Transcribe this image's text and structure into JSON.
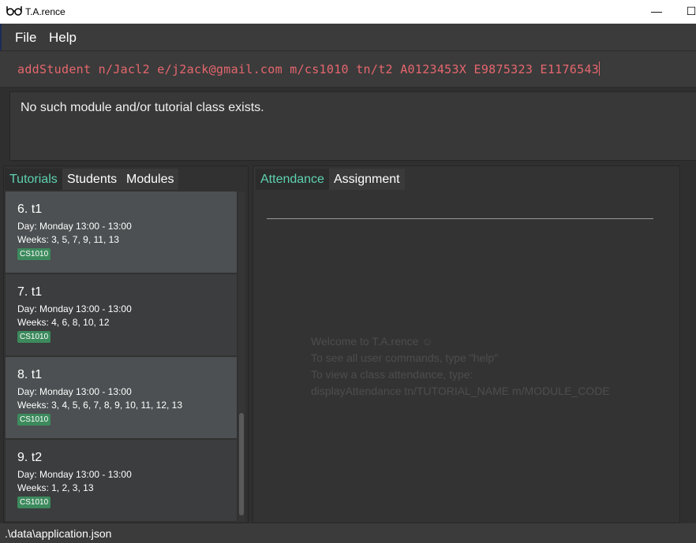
{
  "window": {
    "title": "T.A.rence",
    "minimize_glyph": "—",
    "maximize_glyph": "☐"
  },
  "menu": {
    "items": [
      {
        "label": "File"
      },
      {
        "label": "Help"
      }
    ]
  },
  "command": {
    "text": "addStudent n/Jacl2 e/j2ack@gmail.com m/cs1010 tn/t2 A0123453X E9875323 E1176543"
  },
  "result": {
    "message": "No such module and/or tutorial class exists."
  },
  "left_panel": {
    "tabs": [
      {
        "label": "Tutorials",
        "active": true
      },
      {
        "label": "Students",
        "active": false
      },
      {
        "label": "Modules",
        "active": false
      }
    ],
    "tutorials": [
      {
        "name": "6.  t1",
        "day": "Day: Monday 13:00 - 13:00",
        "weeks": "Weeks: 3, 5, 7, 9, 11, 13",
        "module": "CS1010"
      },
      {
        "name": "7.  t1",
        "day": "Day: Monday 13:00 - 13:00",
        "weeks": "Weeks: 4, 6, 8, 10, 12",
        "module": "CS1010"
      },
      {
        "name": "8.  t1",
        "day": "Day: Monday 13:00 - 13:00",
        "weeks": "Weeks: 3, 4, 5, 6, 7, 8, 9, 10, 11, 12, 13",
        "module": "CS1010"
      },
      {
        "name": "9.  t2",
        "day": "Day: Monday 13:00 - 13:00",
        "weeks": "Weeks: 1, 2, 3, 13",
        "module": "CS1010"
      }
    ]
  },
  "right_panel": {
    "tabs": [
      {
        "label": "Attendance",
        "active": true
      },
      {
        "label": "Assignment",
        "active": false
      }
    ],
    "welcome": {
      "line1": "Welcome to T.A.rence ☺",
      "line2": "To see all user commands, type \"help\"",
      "line3": "To view a class attendance, type:",
      "line4": "displayAttendance tn/TUTORIAL_NAME m/MODULE_CODE"
    }
  },
  "status": {
    "path": ".\\data\\application.json"
  },
  "colors": {
    "accent": "#5ed2b0",
    "command_text": "#e6676e",
    "module_tag": "#3d8a5d"
  }
}
